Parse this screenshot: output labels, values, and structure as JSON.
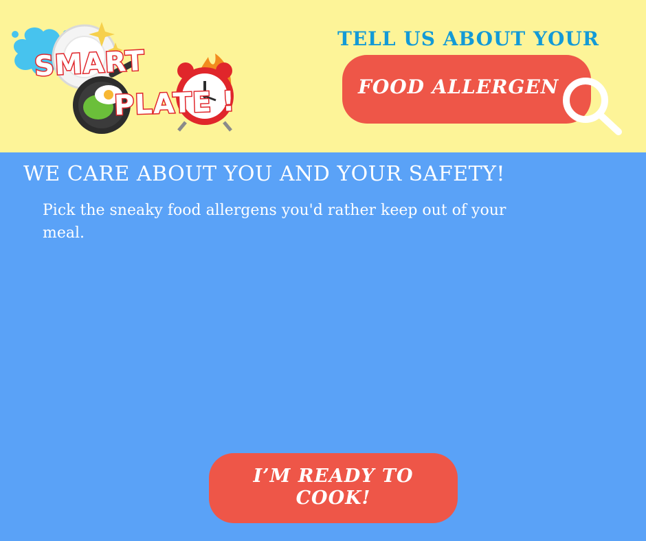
{
  "logo": {
    "word1": "SMART",
    "word2": "PLATE !",
    "icons": [
      "water-splash-icon",
      "frying-pan-icon",
      "alarm-clock-icon",
      "fire-icon",
      "sparkle-icon"
    ]
  },
  "header": {
    "tagline": "TELL US ABOUT YOUR",
    "pill_label": "FOOD ALLERGEN",
    "search_icon": "search-icon"
  },
  "main": {
    "heading": "WE CARE ABOUT YOU AND YOUR SAFETY!",
    "description": "Pick the sneaky food allergens you'd rather keep out of your meal."
  },
  "cta": {
    "label_line1": "I’M READY TO",
    "label_line2": "COOK!"
  },
  "colors": {
    "header_bg": "#fdf498",
    "main_bg": "#5aa2f7",
    "accent": "#ee5648",
    "tagline": "#139ad6",
    "logo_outline": "#e0262b"
  }
}
